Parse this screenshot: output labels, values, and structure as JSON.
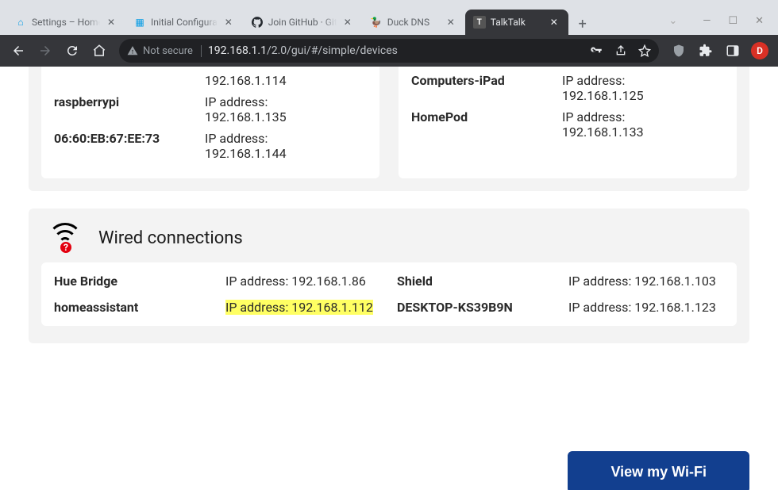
{
  "browser": {
    "tabs": [
      {
        "title": "Settings – Home",
        "favicon": "home"
      },
      {
        "title": "Initial Configura",
        "favicon": "doc"
      },
      {
        "title": "Join GitHub · Git",
        "favicon": "github"
      },
      {
        "title": "Duck DNS",
        "favicon": "duck"
      },
      {
        "title": "TalkTalk",
        "favicon": "tt",
        "active": true
      }
    ],
    "security_label": "Not secure",
    "url_host": "192.168.1.1",
    "url_path": "/2.0/gui/#/simple/devices",
    "avatar_letter": "D"
  },
  "wireless": {
    "left": [
      {
        "name": "",
        "ip": "192.168.1.114"
      },
      {
        "name": "raspberrypi",
        "ip": "192.168.1.135"
      },
      {
        "name": "06:60:EB:67:EE:73",
        "ip": "192.168.1.144"
      }
    ],
    "right": [
      {
        "name": "Computers-iPad",
        "ip": "192.168.1.125"
      },
      {
        "name": "HomePod",
        "ip": "192.168.1.133"
      }
    ],
    "ip_label": "IP address:"
  },
  "wired": {
    "title": "Wired connections",
    "ip_label": "IP address:",
    "rows": [
      {
        "name": "Hue Bridge",
        "ip": "192.168.1.86",
        "name2": "Shield",
        "ip2": "192.168.1.103"
      },
      {
        "name": "homeassistant",
        "ip": "192.168.1.112",
        "highlight": true,
        "name2": "DESKTOP-KS39B9N",
        "ip2": "192.168.1.123"
      }
    ]
  },
  "cta_label": "View my Wi-Fi"
}
